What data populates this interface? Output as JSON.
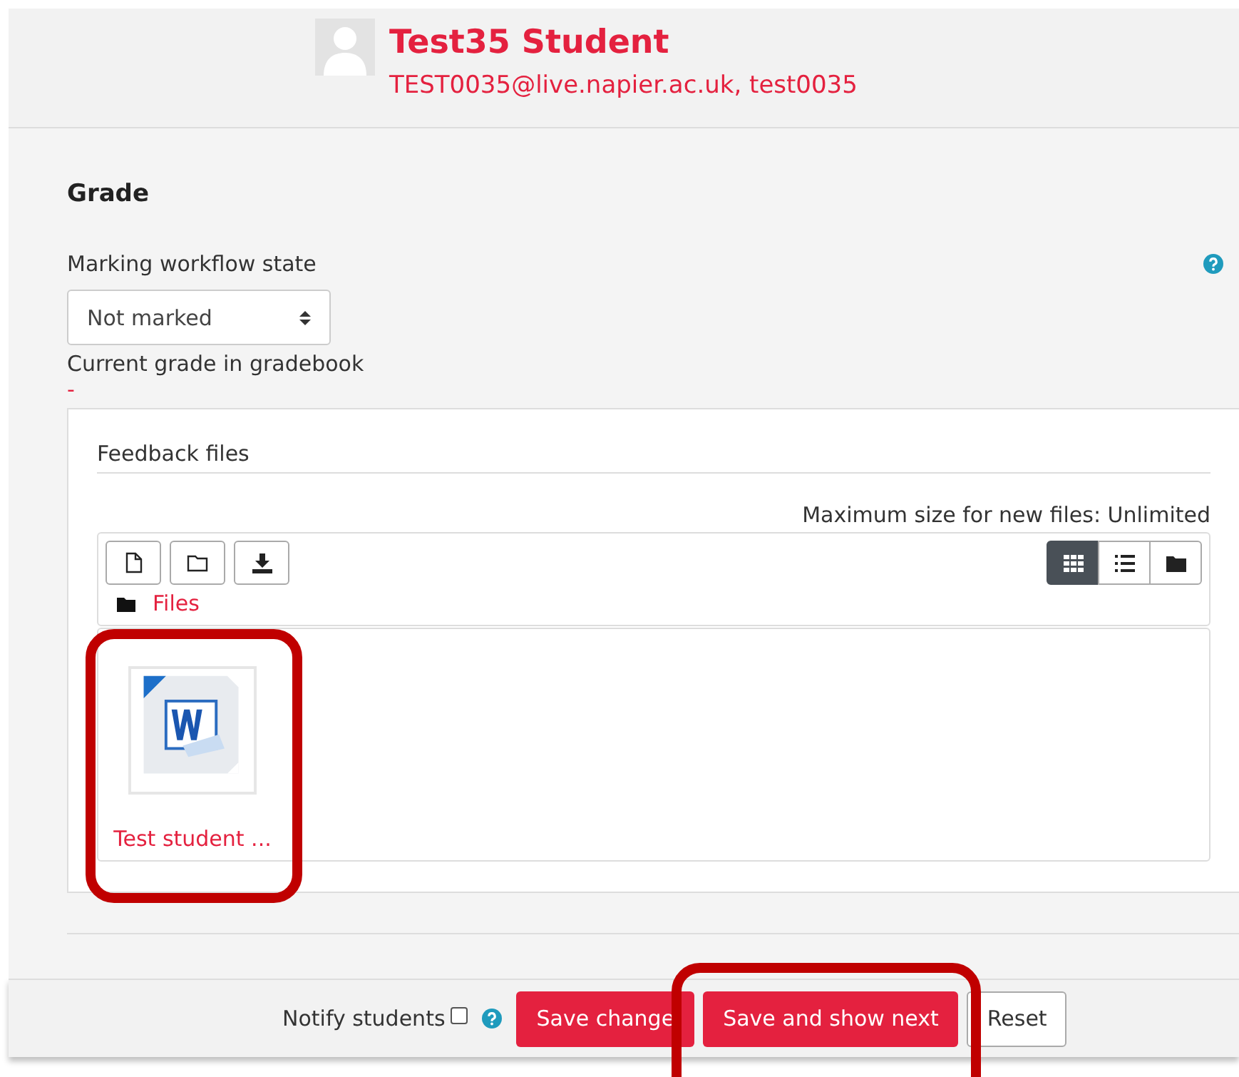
{
  "student": {
    "name": "Test35 Student",
    "details": "TEST0035@live.napier.ac.uk, test0035"
  },
  "grade": {
    "heading": "Grade",
    "workflow_label": "Marking workflow state",
    "workflow_value": "Not marked",
    "current_grade_label": "Current grade in gradebook",
    "current_grade_value": "-"
  },
  "feedback_files": {
    "label": "Feedback files",
    "max_size": "Maximum size for new files: Unlimited",
    "path": "Files",
    "view_modes": [
      {
        "kind": "grid",
        "selected": true
      },
      {
        "kind": "list",
        "selected": false
      },
      {
        "kind": "tree",
        "selected": false
      }
    ],
    "files": [
      {
        "name": "Test student ..."
      }
    ]
  },
  "footer": {
    "notify_label": "Notify students",
    "notify_checked": false,
    "buttons": [
      {
        "label": "Save change",
        "kind": "primary"
      },
      {
        "label": "Save and show next",
        "kind": "primary"
      },
      {
        "label": "Reset",
        "kind": "secondary"
      }
    ]
  }
}
